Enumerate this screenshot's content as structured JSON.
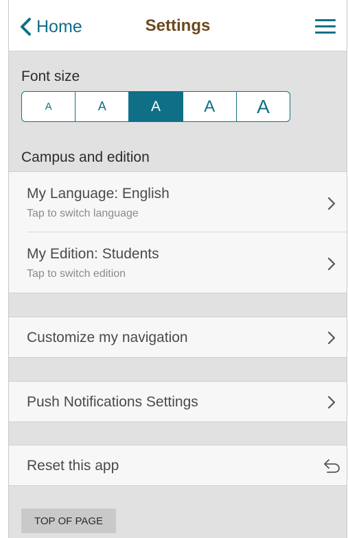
{
  "header": {
    "back_label": "Home",
    "title": "Settings",
    "menu_icon": "hamburger-icon"
  },
  "font_size": {
    "label": "Font size",
    "options": [
      "A",
      "A",
      "A",
      "A",
      "A"
    ],
    "selected_index": 2
  },
  "campus": {
    "section_label": "Campus and edition",
    "items": [
      {
        "title": "My Language: English",
        "subtitle": "Tap to switch language"
      },
      {
        "title": "My Edition: Students",
        "subtitle": "Tap to switch edition"
      }
    ]
  },
  "navigation": {
    "label": "Customize my navigation"
  },
  "notifications": {
    "label": "Push Notifications Settings"
  },
  "reset": {
    "label": "Reset this app"
  },
  "footer": {
    "top_button": "TOP OF PAGE"
  },
  "colors": {
    "accent": "#0f6f86",
    "title": "#6b4a1f",
    "background": "#e1e1e1",
    "card": "#f7f7f7"
  }
}
